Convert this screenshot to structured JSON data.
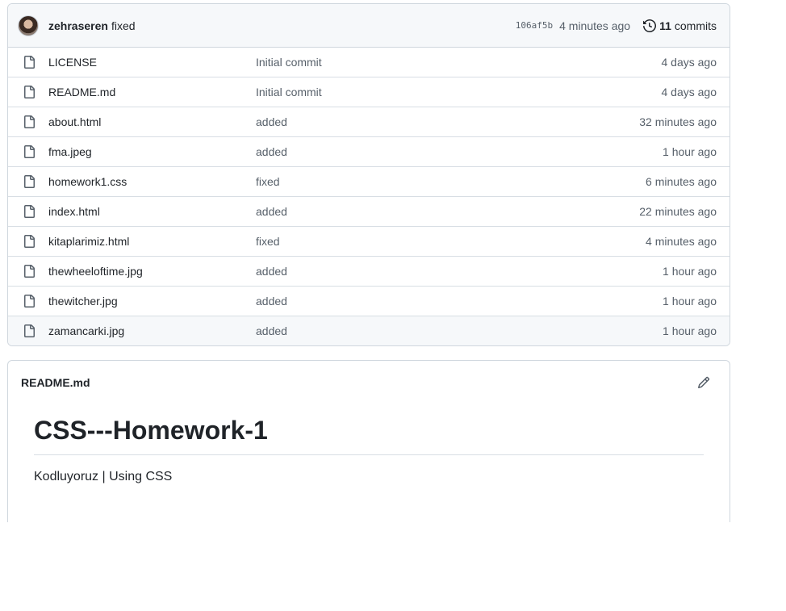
{
  "commit_bar": {
    "author": "zehraseren",
    "message": "fixed",
    "sha": "106af5b",
    "time": "4 minutes ago",
    "commits_count": "11",
    "commits_label": "commits"
  },
  "files": [
    {
      "name": "LICENSE",
      "message": "Initial commit",
      "age": "4 days ago"
    },
    {
      "name": "README.md",
      "message": "Initial commit",
      "age": "4 days ago"
    },
    {
      "name": "about.html",
      "message": "added",
      "age": "32 minutes ago"
    },
    {
      "name": "fma.jpeg",
      "message": "added",
      "age": "1 hour ago"
    },
    {
      "name": "homework1.css",
      "message": "fixed",
      "age": "6 minutes ago"
    },
    {
      "name": "index.html",
      "message": "added",
      "age": "22 minutes ago"
    },
    {
      "name": "kitaplarimiz.html",
      "message": "fixed",
      "age": "4 minutes ago"
    },
    {
      "name": "thewheeloftime.jpg",
      "message": "added",
      "age": "1 hour ago"
    },
    {
      "name": "thewitcher.jpg",
      "message": "added",
      "age": "1 hour ago"
    },
    {
      "name": "zamancarki.jpg",
      "message": "added",
      "age": "1 hour ago"
    }
  ],
  "readme": {
    "filename": "README.md",
    "heading": "CSS---Homework-1",
    "paragraph": "Kodluyoruz | Using CSS"
  },
  "icons": {
    "file": "file-icon",
    "history": "history-icon",
    "edit": "pencil-icon"
  }
}
